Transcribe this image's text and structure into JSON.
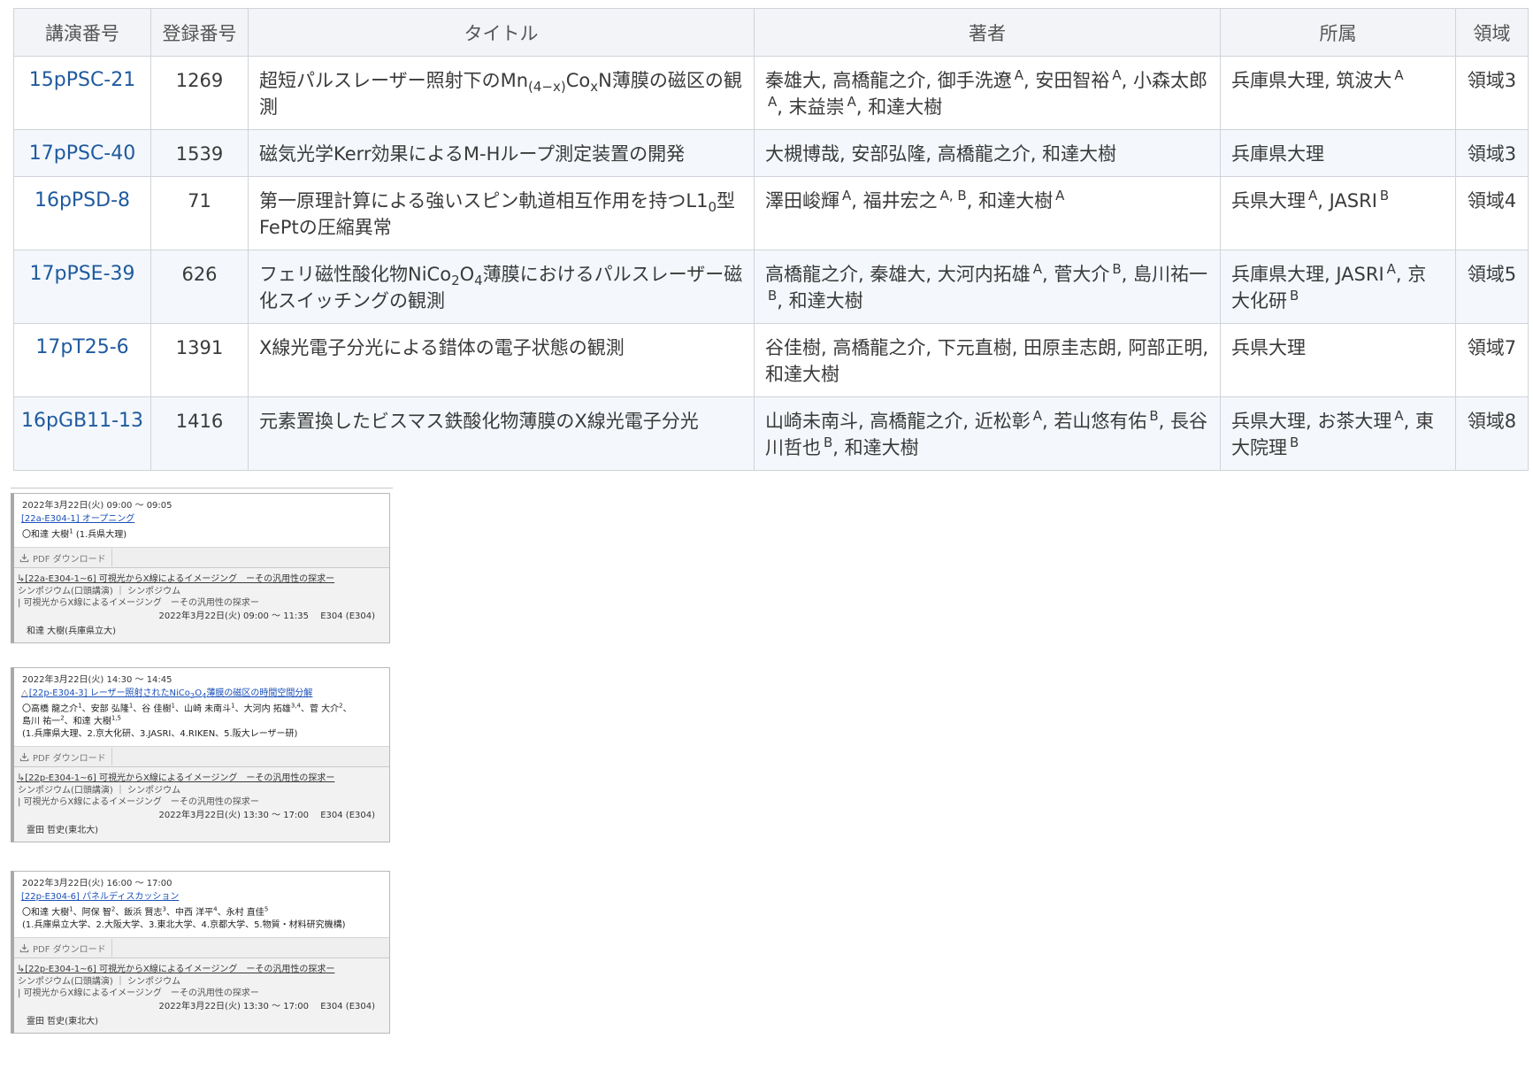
{
  "table": {
    "headers": [
      "講演番号",
      "登録番号",
      "タイトル",
      "著者",
      "所属",
      "領域"
    ],
    "rows": [
      {
        "code": "15pPSC-21",
        "reg": "1269",
        "title": [
          "超短パルスレーザー照射下のMn",
          {
            "sub": "(4−x)"
          },
          "Co",
          {
            "sub": "x"
          },
          "N薄膜の磁区の観測"
        ],
        "authors": [
          "秦雄大, 高橋龍之介, 御手洗遼",
          {
            "sup": "A"
          },
          ", 安田智裕",
          {
            "sup": "A"
          },
          ", 小森太郎",
          {
            "sup": "A"
          },
          ", 末益崇",
          {
            "sup": "A"
          },
          ", 和達大樹"
        ],
        "affil": [
          "兵庫県大理, 筑波大",
          {
            "sup": "A"
          }
        ],
        "area": "領域3"
      },
      {
        "code": "17pPSC-40",
        "reg": "1539",
        "title": [
          "磁気光学Kerr効果によるM-Hループ測定装置の開発"
        ],
        "authors": [
          "大槻博哉, 安部弘隆, 高橋龍之介, 和達大樹"
        ],
        "affil": [
          "兵庫県大理"
        ],
        "area": "領域3"
      },
      {
        "code": "16pPSD-8",
        "reg": "71",
        "title": [
          "第一原理計算による強いスピン軌道相互作用を持つL1",
          {
            "sub": "0"
          },
          "型FePtの圧縮異常"
        ],
        "authors": [
          "澤田峻輝",
          {
            "sup": "A"
          },
          ", 福井宏之",
          {
            "sup": "A, B"
          },
          ", 和達大樹",
          {
            "sup": "A"
          }
        ],
        "affil": [
          "兵県大理",
          {
            "sup": "A"
          },
          ", JASRI",
          {
            "sup": "B"
          }
        ],
        "area": "領域4"
      },
      {
        "code": "17pPSE-39",
        "reg": "626",
        "title": [
          "フェリ磁性酸化物NiCo",
          {
            "sub": "2"
          },
          "O",
          {
            "sub": "4"
          },
          "薄膜におけるパルスレーザー磁化スイッチングの観測"
        ],
        "authors": [
          "高橋龍之介, 秦雄大, 大河内拓雄",
          {
            "sup": "A"
          },
          ", 菅大介",
          {
            "sup": "B"
          },
          ", 島川祐一",
          {
            "sup": "B"
          },
          ", 和達大樹"
        ],
        "affil": [
          "兵庫県大理, JASRI",
          {
            "sup": "A"
          },
          ", 京大化研",
          {
            "sup": "B"
          }
        ],
        "area": "領域5"
      },
      {
        "code": "17pT25-6",
        "reg": "1391",
        "title": [
          "X線光電子分光による錯体の電子状態の観測"
        ],
        "authors": [
          "谷佳樹, 高橋龍之介, 下元直樹, 田原圭志朗, 阿部正明, 和達大樹"
        ],
        "affil": [
          "兵県大理"
        ],
        "area": "領域7"
      },
      {
        "code": "16pGB11-13",
        "reg": "1416",
        "title": [
          "元素置換したビスマス鉄酸化物薄膜のX線光電子分光"
        ],
        "authors": [
          "山崎未南斗, 高橋龍之介, 近松彰",
          {
            "sup": "A"
          },
          ", 若山悠有佑",
          {
            "sup": "B"
          },
          ", 長谷川哲也",
          {
            "sup": "B"
          },
          ", 和達大樹"
        ],
        "affil": [
          "兵県大理, お茶大理",
          {
            "sup": "A"
          },
          ", 東大院理",
          {
            "sup": "B"
          }
        ],
        "area": "領域8"
      }
    ]
  },
  "cards": [
    {
      "time": "2022年3月22日(火) 09:00 〜 09:05",
      "mark": "",
      "title": "[22a-E304-1] オープニング",
      "authors": [
        [
          "〇和達 大樹",
          {
            "sup": "1"
          },
          " (1.兵県大理)"
        ]
      ],
      "pdf_label": "PDF ダウンロード",
      "session_link": "[22a-E304-1~6] 可視光からX線によるイメージング　ーその汎用性の探求ー",
      "session_type": "シンポジウム(口頭講演) ｜ シンポジウム",
      "session_name": "| 可視光からX線によるイメージング　ーその汎用性の探求ー",
      "session_time": "2022年3月22日(火) 09:00 〜 11:35　 E304 (E304)",
      "chair": "和達 大樹(兵庫県立大)"
    },
    {
      "time": "2022年3月22日(火) 14:30 〜 14:45",
      "mark": "△",
      "title": [
        "[22p-E304-3] レーザー照射されたNiCo",
        {
          "sub": "2"
        },
        "O",
        {
          "sub": "4"
        },
        "薄膜の磁区の時間空間分解"
      ],
      "authors": [
        [
          "〇高橋 龍之介",
          {
            "sup": "1"
          },
          "、安部 弘隆",
          {
            "sup": "1"
          },
          "、谷 佳樹",
          {
            "sup": "1"
          },
          "、山崎 未南斗",
          {
            "sup": "1"
          },
          "、大河内 拓雄",
          {
            "sup": "3,4"
          },
          "、菅 大介",
          {
            "sup": "2"
          },
          "、"
        ],
        [
          "島川 祐一",
          {
            "sup": "2"
          },
          "、和達 大樹",
          {
            "sup": "1,5"
          }
        ],
        [
          "(1.兵庫県大理、2.京大化研、3.JASRI、4.RIKEN、5.阪大レーザー研)"
        ]
      ],
      "pdf_label": "PDF ダウンロード",
      "session_link": "[22p-E304-1~6] 可視光からX線によるイメージング　ーその汎用性の探求ー",
      "session_type": "シンポジウム(口頭講演) ｜ シンポジウム",
      "session_name": "| 可視光からX線によるイメージング　ーその汎用性の探求ー",
      "session_time": "2022年3月22日(火) 13:30 〜 17:00　 E304 (E304)",
      "chair": "霊田 哲史(東北大)"
    },
    {
      "time": "2022年3月22日(火) 16:00 〜 17:00",
      "mark": "",
      "title": "[22p-E304-6] パネルディスカッション",
      "authors": [
        [
          "〇和達 大樹",
          {
            "sup": "1"
          },
          "、阿保 智",
          {
            "sup": "2"
          },
          "、飯浜 賢志",
          {
            "sup": "3"
          },
          "、中西 洋平",
          {
            "sup": "4"
          },
          "、永村 直佳",
          {
            "sup": "5"
          }
        ],
        [
          "(1.兵庫県立大学、2.大阪大学、3.東北大学、4.京都大学、5.物質・材料研究機構)"
        ]
      ],
      "pdf_label": "PDF ダウンロード",
      "session_link": "[22p-E304-1~6] 可視光からX線によるイメージング　ーその汎用性の探求ー",
      "session_type": "シンポジウム(口頭講演) ｜ シンポジウム",
      "session_name": "| 可視光からX線によるイメージング　ーその汎用性の探求ー",
      "session_time": "2022年3月22日(火) 13:30 〜 17:00　 E304 (E304)",
      "chair": "霊田 哲史(東北大)"
    }
  ]
}
